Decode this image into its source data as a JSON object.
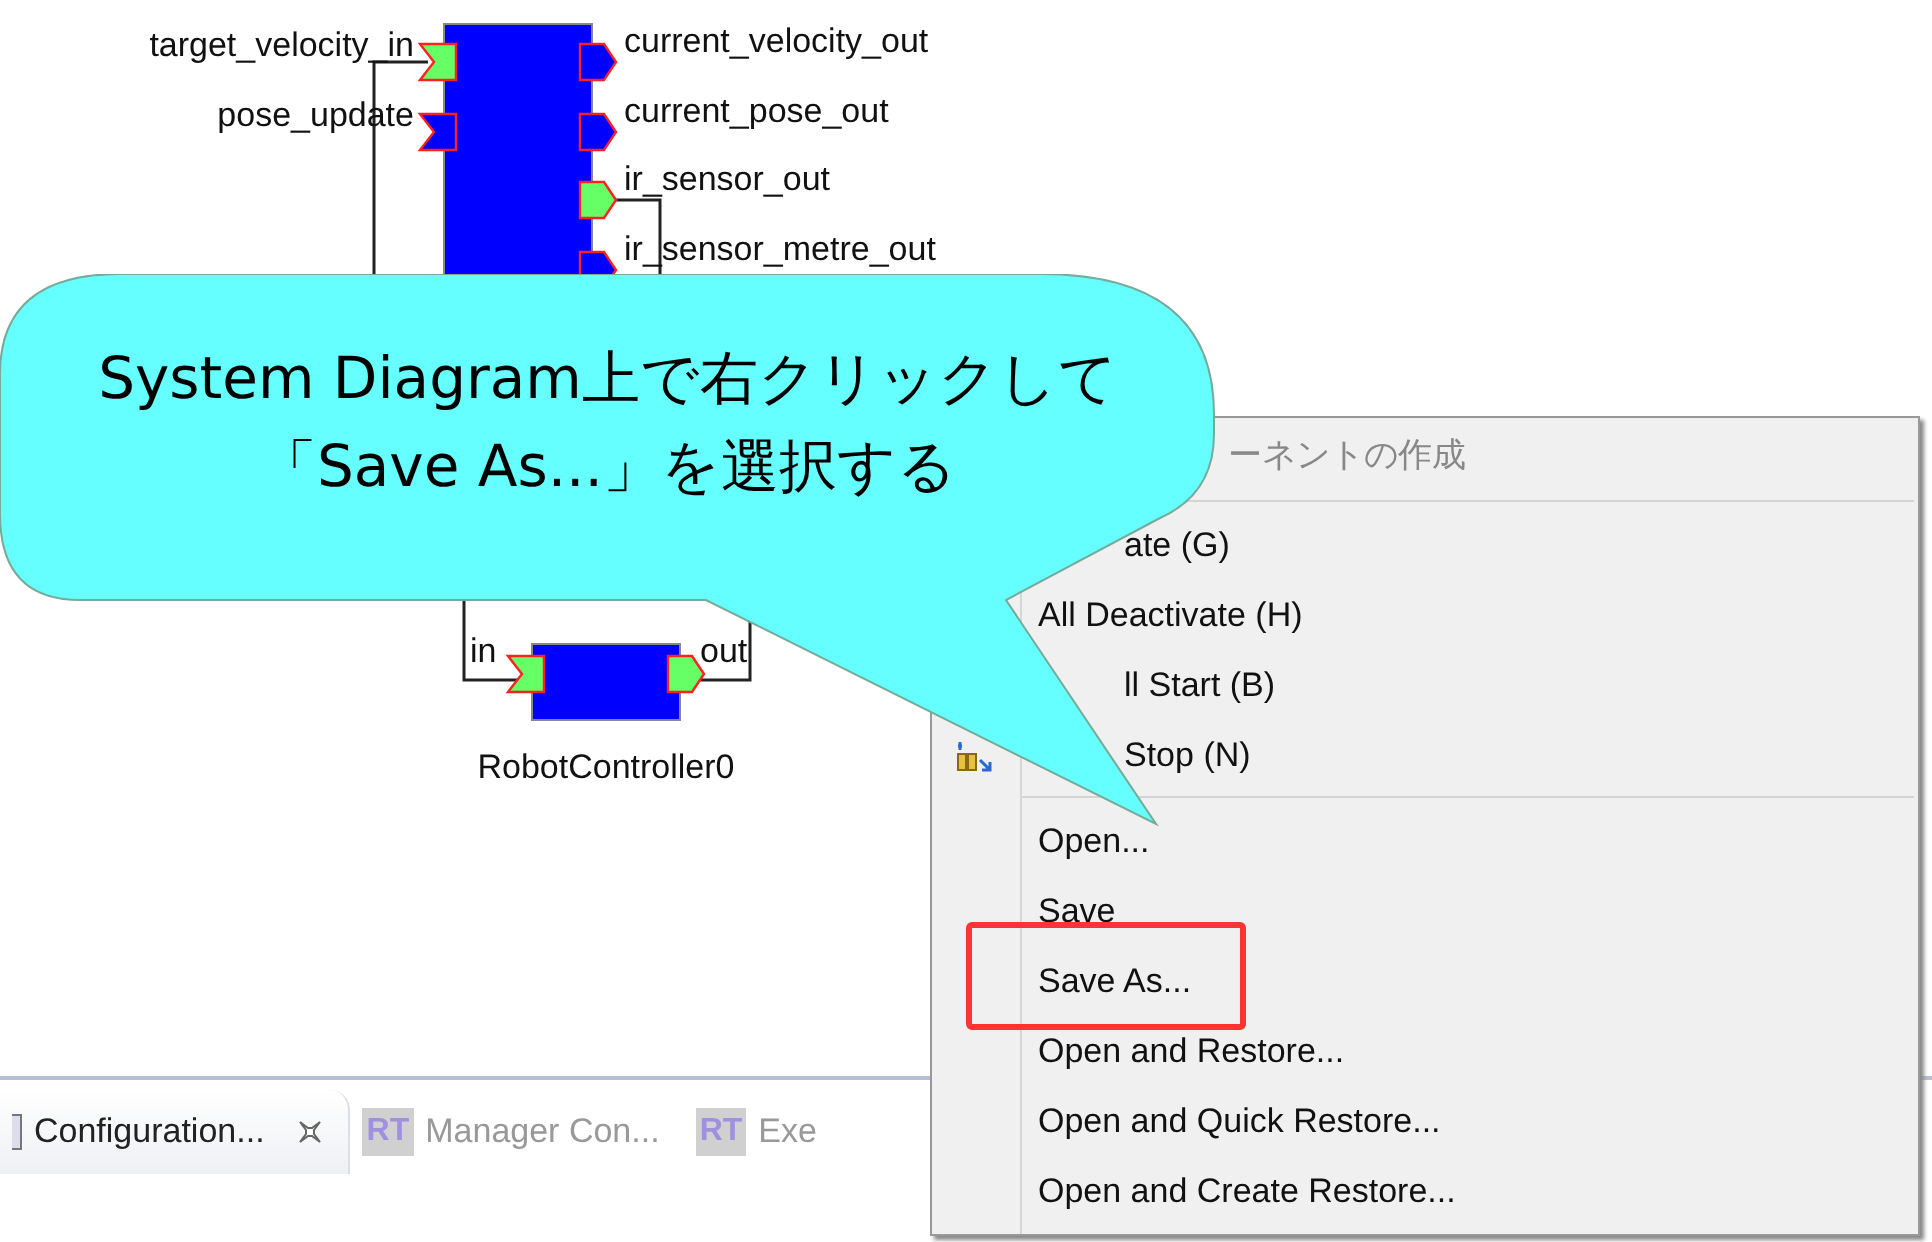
{
  "diagram": {
    "components": [
      {
        "inports": [
          {
            "name": "target_velocity_in",
            "connected": true
          },
          {
            "name": "pose_update",
            "connected": false
          }
        ],
        "outports": [
          {
            "name": "current_velocity_out",
            "connected": false
          },
          {
            "name": "current_pose_out",
            "connected": false
          },
          {
            "name": "ir_sensor_out",
            "connected": true
          },
          {
            "name": "ir_sensor_metre_out",
            "connected": false
          }
        ]
      },
      {
        "name": "RobotController0",
        "inports": [
          {
            "name": "in",
            "connected": true
          }
        ],
        "outports": [
          {
            "name": "out",
            "connected": true
          }
        ]
      }
    ]
  },
  "callout": {
    "lines": [
      "System Diagram上で右クリックして",
      "「Save As...」を選択する"
    ]
  },
  "tabs": [
    {
      "label": "Configuration...",
      "selected": true,
      "closable": true
    },
    {
      "label": "Manager Con...",
      "selected": false,
      "icon_text": "RT",
      "closable": false
    },
    {
      "label": "Exe",
      "selected": false,
      "icon_text": "RT",
      "closable": false
    }
  ],
  "context_menu": {
    "items": [
      {
        "kind": "header",
        "label": "ーネントの作成",
        "disabled": true,
        "annotated": false
      },
      {
        "kind": "separator"
      },
      {
        "kind": "partial",
        "label": "ate (G)",
        "disabled": false,
        "annotated": false
      },
      {
        "kind": "item",
        "label": "All Deactivate (H)",
        "disabled": false,
        "annotated": false
      },
      {
        "kind": "partial",
        "label": "ll Start (B)",
        "disabled": false,
        "annotated": false
      },
      {
        "kind": "iconpartial",
        "label": "Stop (N)",
        "disabled": false,
        "annotated": false
      },
      {
        "kind": "separator"
      },
      {
        "kind": "item",
        "label": "Open...",
        "disabled": false,
        "annotated": false
      },
      {
        "kind": "item",
        "label": "Save",
        "disabled": false,
        "annotated": false
      },
      {
        "kind": "item",
        "label": "Save As...",
        "disabled": false,
        "annotated": true
      },
      {
        "kind": "item",
        "label": "Open and Restore...",
        "disabled": false,
        "annotated": false
      },
      {
        "kind": "item",
        "label": "Open and Quick Restore...",
        "disabled": false,
        "annotated": false
      },
      {
        "kind": "item",
        "label": "Open and Create Restore...",
        "disabled": false,
        "annotated": false
      }
    ]
  }
}
